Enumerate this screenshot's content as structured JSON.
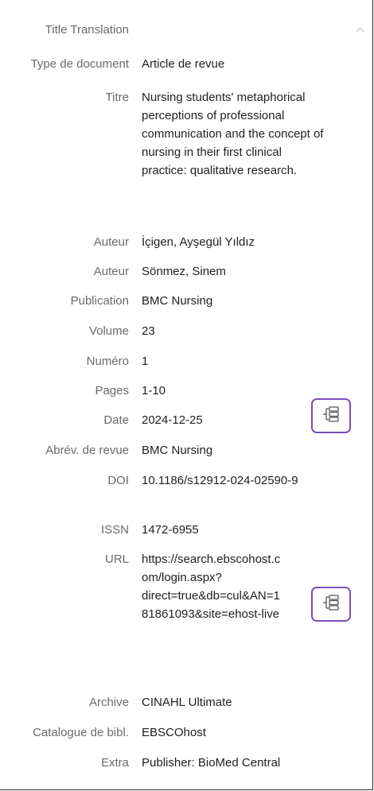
{
  "fields": [
    {
      "label": "Title Translation",
      "value": ""
    },
    {
      "label": "Type de document",
      "value": "Article de revue"
    },
    {
      "label": "Titre",
      "value": "Nursing students' metaphorical perceptions of professional communication and the concept of nursing in their first clinical practice: qualitative research."
    },
    {
      "label": "Auteur",
      "value": "İçigen, Ayşegül Yıldız"
    },
    {
      "label": "Auteur",
      "value": "Sönmez, Sinem"
    },
    {
      "label": "Publication",
      "value": "BMC Nursing"
    },
    {
      "label": "Volume",
      "value": "23"
    },
    {
      "label": "Numéro",
      "value": "1"
    },
    {
      "label": "Pages",
      "value": "1-10"
    },
    {
      "label": "Date",
      "value": "2024-12-25"
    },
    {
      "label": "Abrév. de revue",
      "value": "BMC Nursing"
    },
    {
      "label": "DOI",
      "value": "10.1186/s12912-024-02590-9"
    },
    {
      "label": "ISSN",
      "value": "1472-6955"
    },
    {
      "label": "URL",
      "value": "https://search.ebscohost.com/login.aspx?direct=true&db=cul&AN=181861093&site=ehost-live"
    },
    {
      "label": "Archive",
      "value": "CINAHL Ultimate"
    },
    {
      "label": "Catalogue de bibl.",
      "value": "EBSCOhost"
    },
    {
      "label": "Extra",
      "value": "Publisher: BioMed Central"
    }
  ],
  "icons": {
    "tree_button": "tree-view-icon",
    "scroll": "chevron-up-icon"
  },
  "colors": {
    "highlight_border": "#7a4fbe",
    "label_text": "#6a6a6a",
    "value_text": "#1f1f1f"
  }
}
